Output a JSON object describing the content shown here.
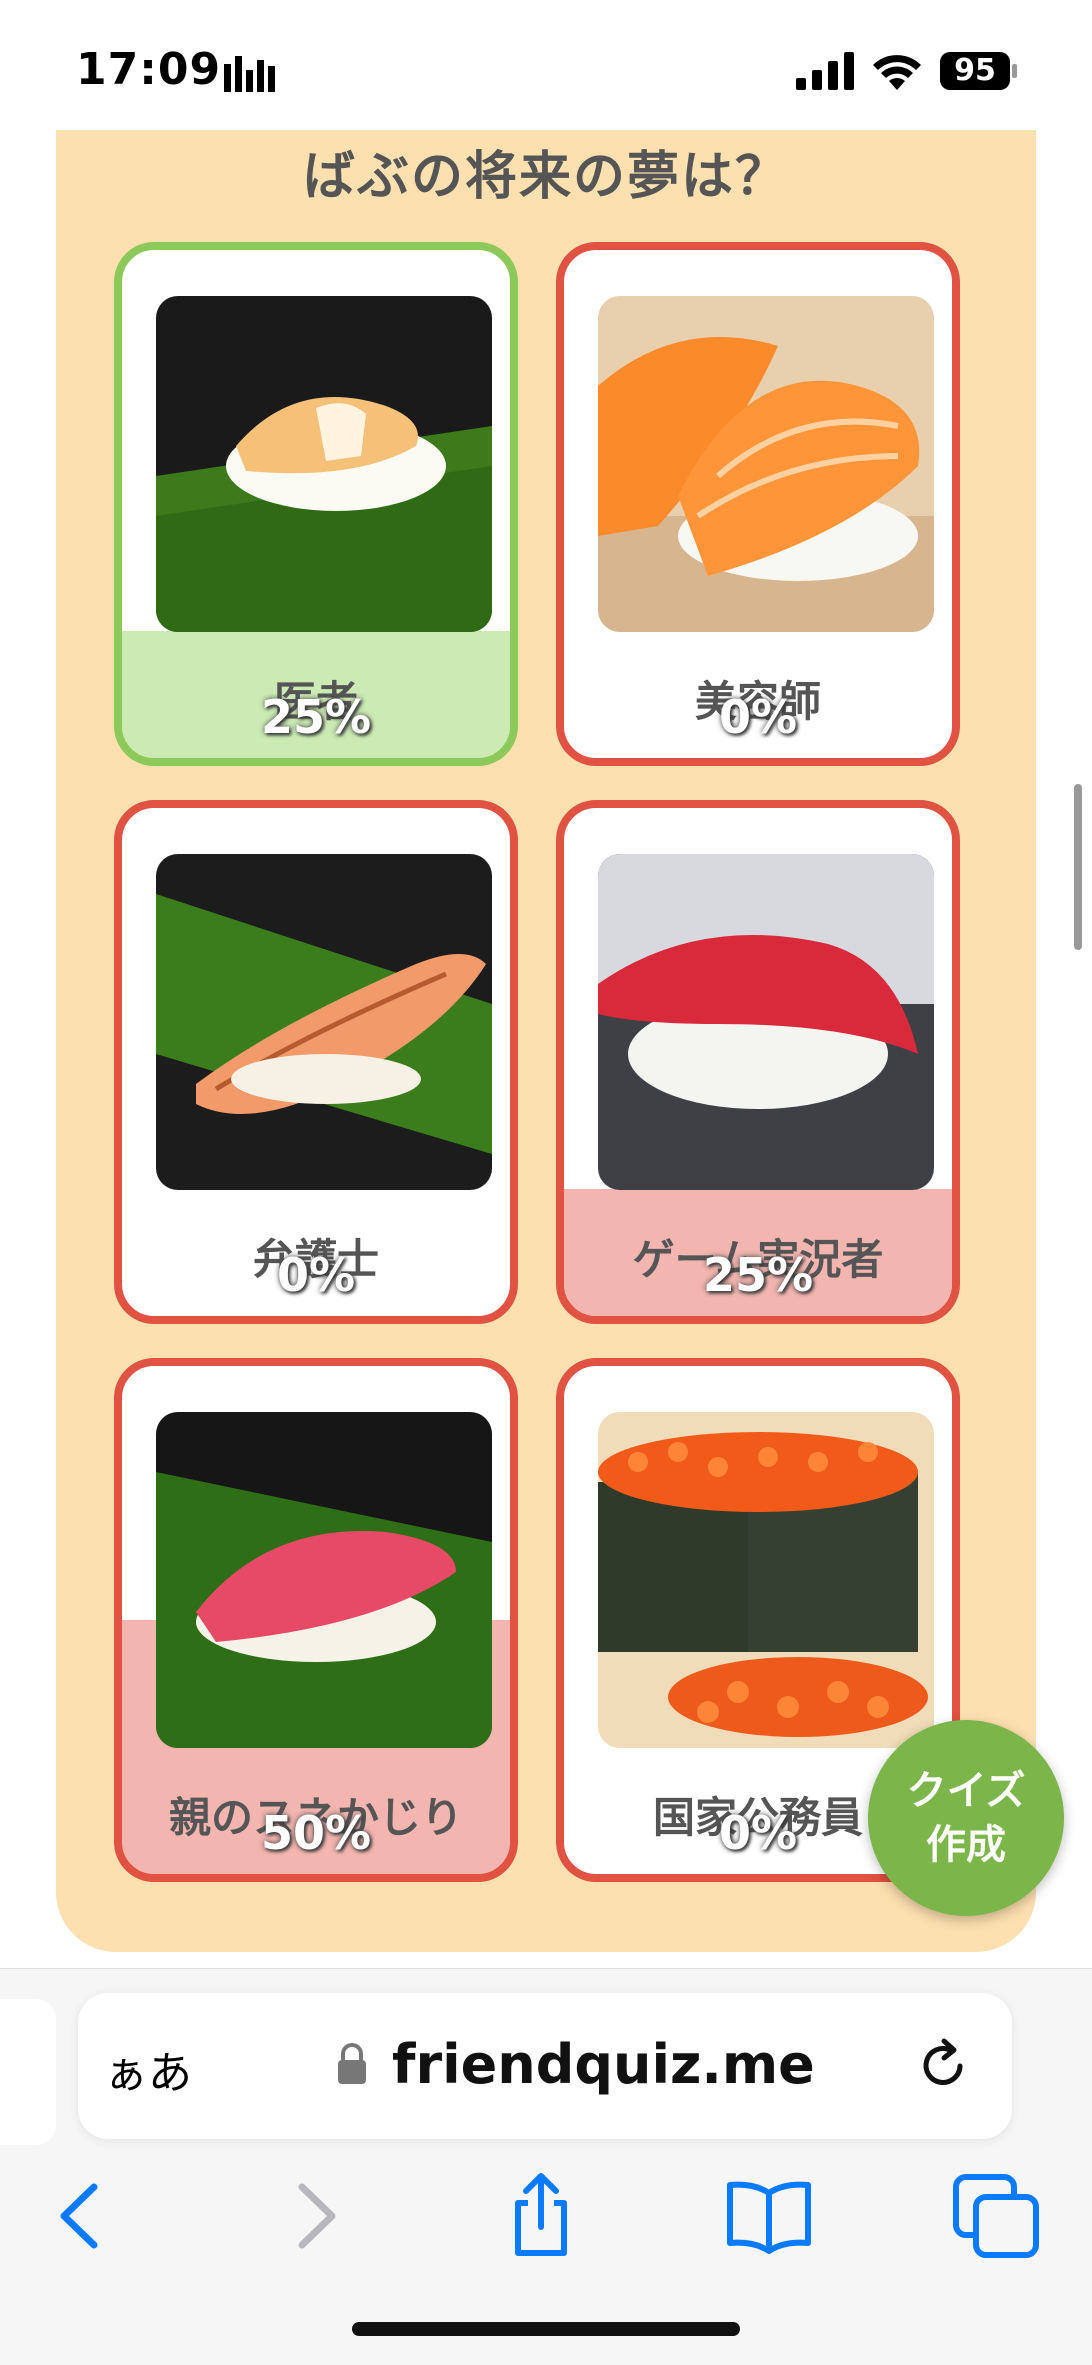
{
  "status": {
    "time": "17:09",
    "battery": "95"
  },
  "quiz": {
    "question": "ばぶの将来の夢は？",
    "options": [
      {
        "label": "医者",
        "percent": "25%",
        "correct": true,
        "fill": 0.25
      },
      {
        "label": "美容師",
        "percent": "0%",
        "correct": false,
        "fill": 0
      },
      {
        "label": "弁護士",
        "percent": "0%",
        "correct": false,
        "fill": 0
      },
      {
        "label": "ゲーム実況者",
        "percent": "25%",
        "correct": false,
        "fill": 0.25
      },
      {
        "label": "親のスネかじり",
        "percent": "50%",
        "correct": false,
        "fill": 0.5
      },
      {
        "label": "国家公務員",
        "percent": "0%",
        "correct": false,
        "fill": 0
      }
    ]
  },
  "fab": {
    "line1": "クイズ",
    "line2": "作成"
  },
  "browser": {
    "aa_label": "ぁあ",
    "url": "friendquiz.me"
  },
  "colors": {
    "panel": "#fde0b0",
    "correct_border": "#8cc85a",
    "wrong_border": "#e05242",
    "fab": "#7cb64a",
    "accent": "#0a7aff"
  }
}
